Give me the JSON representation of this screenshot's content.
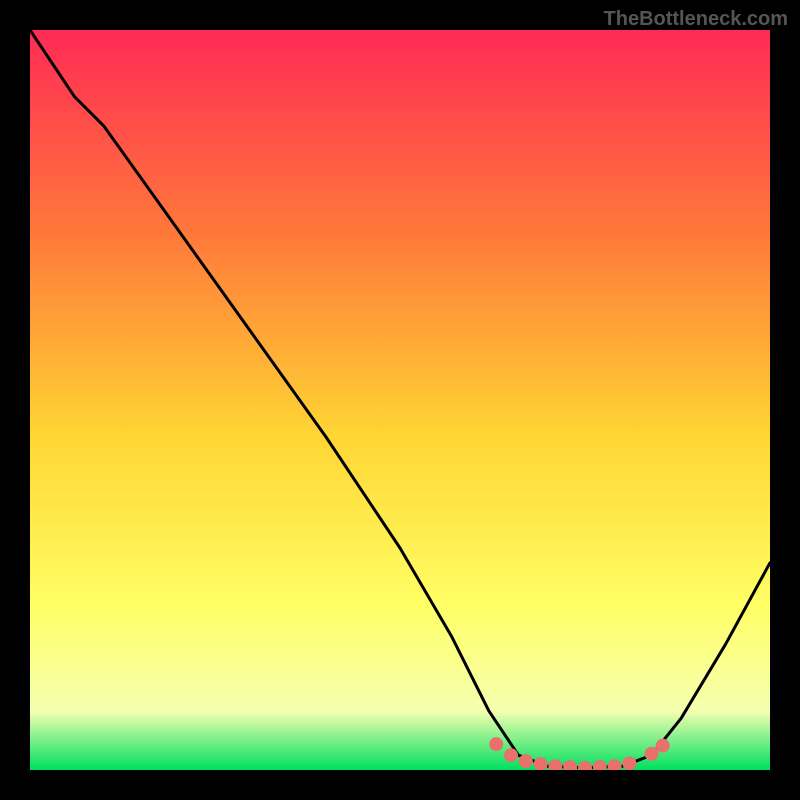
{
  "watermark": "TheBottleneck.com",
  "chart_data": {
    "type": "line",
    "title": "",
    "xlabel": "",
    "ylabel": "",
    "xlim": [
      0,
      100
    ],
    "ylim": [
      0,
      100
    ],
    "gradient_colors": {
      "top": "#ff2a55",
      "mid_upper": "#ff7a3a",
      "mid": "#ffd633",
      "mid_lower": "#ffff66",
      "lower": "#f5ffb0",
      "bottom": "#00e060"
    },
    "curve": [
      {
        "x": 0,
        "y": 100
      },
      {
        "x": 6,
        "y": 91
      },
      {
        "x": 10,
        "y": 87
      },
      {
        "x": 20,
        "y": 73
      },
      {
        "x": 30,
        "y": 59
      },
      {
        "x": 40,
        "y": 45
      },
      {
        "x": 50,
        "y": 30
      },
      {
        "x": 57,
        "y": 18
      },
      {
        "x": 62,
        "y": 8
      },
      {
        "x": 66,
        "y": 2
      },
      {
        "x": 70,
        "y": 0.5
      },
      {
        "x": 75,
        "y": 0.3
      },
      {
        "x": 80,
        "y": 0.5
      },
      {
        "x": 84,
        "y": 2
      },
      {
        "x": 88,
        "y": 7
      },
      {
        "x": 94,
        "y": 17
      },
      {
        "x": 100,
        "y": 28
      }
    ],
    "markers": [
      {
        "x": 63,
        "y": 3.5
      },
      {
        "x": 65,
        "y": 2
      },
      {
        "x": 67,
        "y": 1.2
      },
      {
        "x": 69,
        "y": 0.8
      },
      {
        "x": 71,
        "y": 0.5
      },
      {
        "x": 73,
        "y": 0.4
      },
      {
        "x": 75,
        "y": 0.3
      },
      {
        "x": 77,
        "y": 0.4
      },
      {
        "x": 79,
        "y": 0.5
      },
      {
        "x": 81,
        "y": 0.9
      },
      {
        "x": 84,
        "y": 2.2
      },
      {
        "x": 85.5,
        "y": 3.3
      }
    ],
    "marker_color": "#e8716b",
    "curve_color": "#000000"
  }
}
